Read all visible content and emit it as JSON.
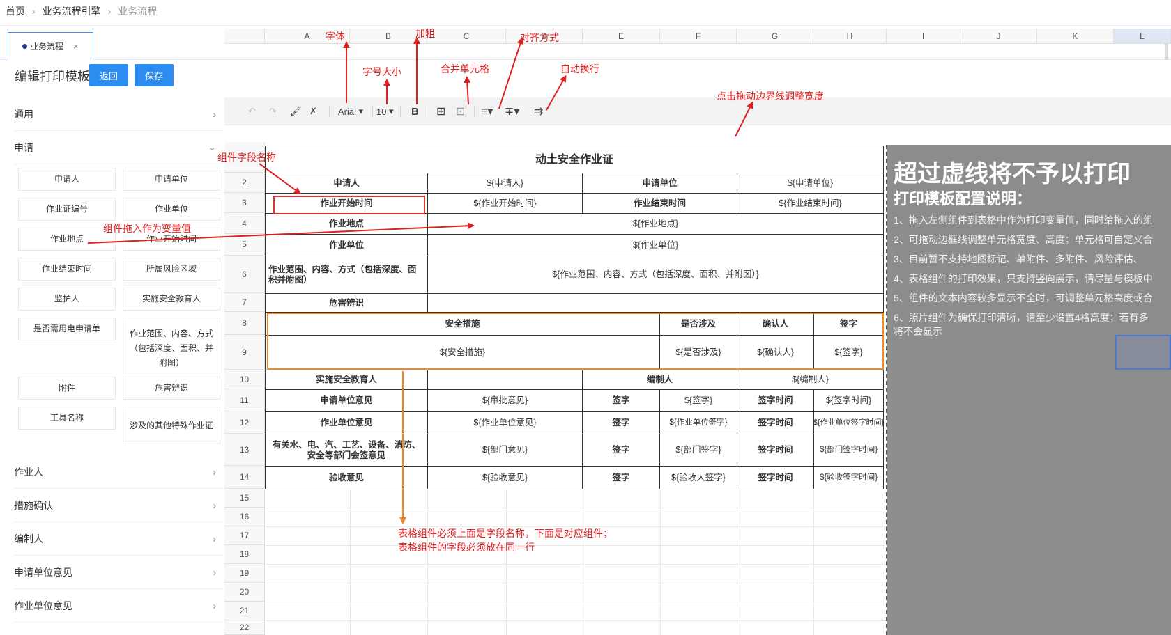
{
  "breadcrumb": {
    "home": "首页",
    "level1": "业务流程引擎",
    "current": "业务流程"
  },
  "tab": {
    "label": "业务流程",
    "close": "×"
  },
  "header": {
    "title": "编辑打印模板",
    "back_label": "返回",
    "save_label": "保存"
  },
  "sidebar": {
    "sections": {
      "general": "通用",
      "apply": "申请",
      "worker": "作业人",
      "measures": "措施确认",
      "editor": "编制人",
      "apply_unit_opinion": "申请单位意见",
      "work_unit_opinion": "作业单位意见"
    },
    "items": [
      "申请人",
      "申请单位",
      "作业证编号",
      "作业单位",
      "作业地点",
      "作业开始时间",
      "作业结束时间",
      "所属风险区域",
      "监护人",
      "实施安全教育人",
      "是否需用电申请单",
      "作业范围、内容、方式（包括深度、面积、并附图）",
      "附件",
      "危害辨识",
      "工具名称",
      "涉及的其他特殊作业证"
    ]
  },
  "toolbar": {
    "font": "Arial",
    "size": "10"
  },
  "columns": [
    "A",
    "B",
    "C",
    "D",
    "E",
    "F",
    "G",
    "H",
    "I",
    "J",
    "K",
    "L"
  ],
  "rows": [
    "2",
    "3",
    "4",
    "5",
    "6",
    "7",
    "8",
    "9",
    "10",
    "11",
    "12",
    "13",
    "14",
    "15",
    "16",
    "17",
    "18",
    "19",
    "20",
    "21",
    "22"
  ],
  "sheet": {
    "title": "动土安全作业证",
    "c": {
      "r2a": "申请人",
      "r2c": "${申请人}",
      "r2e": "申请单位",
      "r2g": "${申请单位}",
      "r3a": "作业开始时间",
      "r3c": "${作业开始时间}",
      "r3e": "作业结束时间",
      "r3g": "${作业结束时间}",
      "r4a": "作业地点",
      "r4c": "${作业地点}",
      "r5a": "作业单位",
      "r5c": "${作业单位}",
      "r6a": "作业范围、内容、方式（包括深度、面积并附图）",
      "r6c": "${作业范围、内容、方式（包括深度、面积、并附图）}",
      "r7a": "危害辨识",
      "r8a": "安全措施",
      "r8f": "是否涉及",
      "r8g": "确认人",
      "r8h": "签字",
      "r9a": "${安全措施}",
      "r9f": "${是否涉及}",
      "r9g": "${确认人}",
      "r9h": "${签字}",
      "r10a": "实施安全教育人",
      "r10e": "编制人",
      "r10g": "${编制人}",
      "r11a": "申请单位意见",
      "r11c": "${审批意见}",
      "r11e": "签字",
      "r11f": "${签字}",
      "r11g": "签字时间",
      "r11h": "${签字时间}",
      "r12a": "作业单位意见",
      "r12c": "${作业单位意见}",
      "r12e": "签字",
      "r12f": "${作业单位签字}",
      "r12g": "签字时间",
      "r12h": "${作业单位签字时间}",
      "r13a": "有关水、电、汽、工艺、设备、消防、安全等部门会签意见",
      "r13c": "${部门意见}",
      "r13e": "签字",
      "r13f": "${部门签字}",
      "r13g": "签字时间",
      "r13h": "${部门签字时间}",
      "r14a": "验收意见",
      "r14c": "${验收意见}",
      "r14e": "签字",
      "r14f": "${验收人签字}",
      "r14g": "签字时间",
      "r14h": "${验收签字时间}"
    }
  },
  "overlay": {
    "warning": "超过虚线将不予以打印",
    "title": "打印模板配置说明：",
    "lines": [
      "1、拖入左侧组件到表格中作为打印变量值，同时给拖入的组",
      "2、可拖动边框线调整单元格宽度、高度；单元格可自定义合",
      "3、目前暂不支持地图标记、单附件、多附件、风险评估、",
      "4、表格组件的打印效果，只支持竖向展示，请尽量与模板中",
      "5、组件的文本内容较多显示不全时，可调整单元格高度或合",
      "6、照片组件为确保打印清晰，请至少设置4格高度；若有多",
      "将不会显示"
    ]
  },
  "annotations": {
    "font": "字体",
    "size": "字号大小",
    "bold": "加粗",
    "merge": "合并单元格",
    "align": "对齐方式",
    "wrap": "自动换行",
    "drag": "点击拖动边界线调整宽度",
    "field_name": "组件字段名称",
    "drag_in": "组件拖入作为变量值",
    "table_rule_1": "表格组件必须上面是字段名称，下面是对应组件；",
    "table_rule_2": "表格组件的字段必须放在同一行"
  },
  "colors": {
    "accent": "#2d8cf0",
    "annotation": "#e02020",
    "highlight": "#f08a24"
  }
}
